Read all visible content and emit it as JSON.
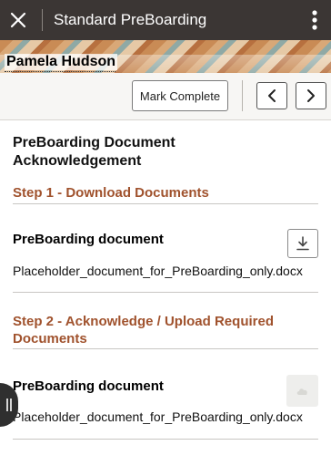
{
  "header": {
    "title": "Standard PreBoarding",
    "close_icon": "close-icon",
    "menu_icon": "more-vertical-icon"
  },
  "person": {
    "name": "Pamela Hudson"
  },
  "toolbar": {
    "mark_complete_label": "Mark Complete",
    "prev_icon": "chevron-left-icon",
    "next_icon": "chevron-right-icon"
  },
  "content": {
    "page_title": "PreBoarding Document Acknowledgement",
    "steps": [
      {
        "title": "Step 1 - Download Documents",
        "doc_title": "PreBoarding document",
        "file_name": "Placeholder_document_for_PreBoarding_only.docx",
        "action_icon": "download-icon"
      },
      {
        "title": "Step 2 - Acknowledge / Upload Required Documents",
        "doc_title": "PreBoarding document",
        "file_name": "Placeholder_document_for_PreBoarding_only.docx",
        "action_icon": "upload-icon"
      }
    ]
  },
  "colors": {
    "topbar": "#3b3634",
    "step_title": "#a0522d",
    "rule": "#c8c6c3"
  }
}
